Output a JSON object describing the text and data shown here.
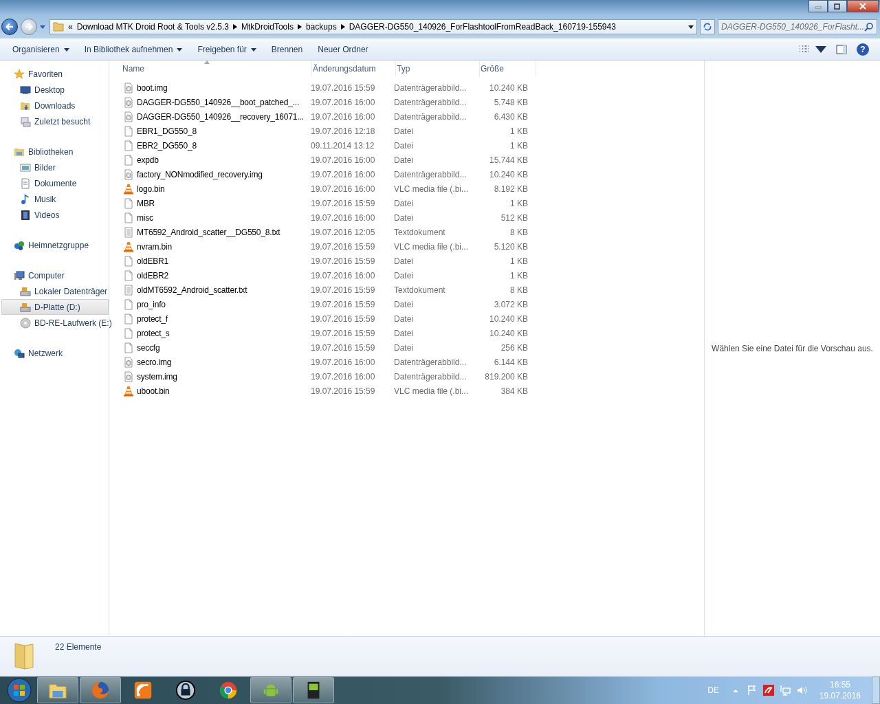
{
  "address": {
    "overflow": "«",
    "segments": [
      "Download MTK Droid Root & Tools v2.5.3",
      "MtkDroidTools",
      "backups",
      "DAGGER-DG550_140926_ForFlashtoolFromReadBack_160719-155943"
    ]
  },
  "search": {
    "placeholder": "DAGGER-DG550_140926_ForFlasht..."
  },
  "toolbar": [
    {
      "label": "Organisieren",
      "dropdown": true
    },
    {
      "label": "In Bibliothek aufnehmen",
      "dropdown": true
    },
    {
      "label": "Freigeben für",
      "dropdown": true
    },
    {
      "label": "Brennen",
      "dropdown": false
    },
    {
      "label": "Neuer Ordner",
      "dropdown": false
    }
  ],
  "nav": [
    {
      "label": "Favoriten",
      "kind": "star",
      "selected": false,
      "children": [
        {
          "label": "Desktop",
          "kind": "desktop",
          "selected": false
        },
        {
          "label": "Downloads",
          "kind": "downloads",
          "selected": false
        },
        {
          "label": "Zuletzt besucht",
          "kind": "recent",
          "selected": false
        }
      ]
    },
    {
      "label": "Bibliotheken",
      "kind": "library",
      "selected": false,
      "children": [
        {
          "label": "Bilder",
          "kind": "pictures",
          "selected": false
        },
        {
          "label": "Dokumente",
          "kind": "documents",
          "selected": false
        },
        {
          "label": "Musik",
          "kind": "music",
          "selected": false
        },
        {
          "label": "Videos",
          "kind": "videos",
          "selected": false
        }
      ]
    },
    {
      "label": "Heimnetzgruppe",
      "kind": "homegroup",
      "selected": false
    },
    {
      "label": "Computer",
      "kind": "computer",
      "selected": false,
      "children": [
        {
          "label": "Lokaler Datenträger",
          "kind": "drive",
          "selected": false
        },
        {
          "label": "D-Platte (D:)",
          "kind": "drive",
          "selected": true
        },
        {
          "label": "BD-RE-Laufwerk (E:)",
          "kind": "disc",
          "selected": false
        }
      ]
    },
    {
      "label": "Netzwerk",
      "kind": "network",
      "selected": false
    }
  ],
  "help_button": "?",
  "table": {
    "columns": [
      {
        "label": "Name",
        "sorted": true
      },
      {
        "label": "Änderungsdatum",
        "sorted": false
      },
      {
        "label": "Typ",
        "sorted": false
      },
      {
        "label": "Größe",
        "sorted": false
      }
    ],
    "rows": [
      {
        "kind": "image",
        "name": "boot.img",
        "date": "19.07.2016 15:59",
        "type": "Datenträgerabbild...",
        "size": "10.240 KB"
      },
      {
        "kind": "image",
        "name": "DAGGER-DG550_140926__boot_patched_...",
        "date": "19.07.2016 16:00",
        "type": "Datenträgerabbild...",
        "size": "5.748 KB"
      },
      {
        "kind": "image",
        "name": "DAGGER-DG550_140926__recovery_16071...",
        "date": "19.07.2016 16:00",
        "type": "Datenträgerabbild...",
        "size": "6.430 KB"
      },
      {
        "kind": "file",
        "name": "EBR1_DG550_8",
        "date": "19.07.2016 12:18",
        "type": "Datei",
        "size": "1 KB"
      },
      {
        "kind": "file",
        "name": "EBR2_DG550_8",
        "date": "09.11.2014 13:12",
        "type": "Datei",
        "size": "1 KB"
      },
      {
        "kind": "file",
        "name": "expdb",
        "date": "19.07.2016 16:00",
        "type": "Datei",
        "size": "15.744 KB"
      },
      {
        "kind": "image",
        "name": "factory_NONmodified_recovery.img",
        "date": "19.07.2016 16:00",
        "type": "Datenträgerabbild...",
        "size": "10.240 KB"
      },
      {
        "kind": "vlc",
        "name": "logo.bin",
        "date": "19.07.2016 16:00",
        "type": "VLC media file (.bi...",
        "size": "8.192 KB"
      },
      {
        "kind": "file",
        "name": "MBR",
        "date": "19.07.2016 15:59",
        "type": "Datei",
        "size": "1 KB"
      },
      {
        "kind": "file",
        "name": "misc",
        "date": "19.07.2016 16:00",
        "type": "Datei",
        "size": "512 KB"
      },
      {
        "kind": "text",
        "name": "MT6592_Android_scatter__DG550_8.txt",
        "date": "19.07.2016 12:05",
        "type": "Textdokument",
        "size": "8 KB"
      },
      {
        "kind": "vlc",
        "name": "nvram.bin",
        "date": "19.07.2016 15:59",
        "type": "VLC media file (.bi...",
        "size": "5.120 KB"
      },
      {
        "kind": "file",
        "name": "oldEBR1",
        "date": "19.07.2016 15:59",
        "type": "Datei",
        "size": "1 KB"
      },
      {
        "kind": "file",
        "name": "oldEBR2",
        "date": "19.07.2016 16:00",
        "type": "Datei",
        "size": "1 KB"
      },
      {
        "kind": "text",
        "name": "oldMT6592_Android_scatter.txt",
        "date": "19.07.2016 15:59",
        "type": "Textdokument",
        "size": "8 KB"
      },
      {
        "kind": "file",
        "name": "pro_info",
        "date": "19.07.2016 15:59",
        "type": "Datei",
        "size": "3.072 KB"
      },
      {
        "kind": "file",
        "name": "protect_f",
        "date": "19.07.2016 15:59",
        "type": "Datei",
        "size": "10.240 KB"
      },
      {
        "kind": "file",
        "name": "protect_s",
        "date": "19.07.2016 15:59",
        "type": "Datei",
        "size": "10.240 KB"
      },
      {
        "kind": "file",
        "name": "seccfg",
        "date": "19.07.2016 15:59",
        "type": "Datei",
        "size": "256 KB"
      },
      {
        "kind": "image",
        "name": "secro.img",
        "date": "19.07.2016 16:00",
        "type": "Datenträgerabbild...",
        "size": "6.144 KB"
      },
      {
        "kind": "image",
        "name": "system.img",
        "date": "19.07.2016 16:00",
        "type": "Datenträgerabbild...",
        "size": "819.200 KB"
      },
      {
        "kind": "vlc",
        "name": "uboot.bin",
        "date": "19.07.2016 15:59",
        "type": "VLC media file (.bi...",
        "size": "384 KB"
      }
    ]
  },
  "preview": {
    "message": "Wählen Sie eine Datei für die Vorschau aus."
  },
  "details": {
    "count": "22 Elemente"
  },
  "taskbar": {
    "apps": [
      {
        "kind": "explorer",
        "running": true
      },
      {
        "kind": "firefox",
        "running": true
      },
      {
        "kind": "feed",
        "running": false
      },
      {
        "kind": "lock",
        "running": false
      },
      {
        "kind": "chrome",
        "running": false
      },
      {
        "kind": "android",
        "running": true
      },
      {
        "kind": "android-box",
        "running": true
      }
    ],
    "language": "DE",
    "time": "16:55",
    "date": "19.07.2016"
  }
}
